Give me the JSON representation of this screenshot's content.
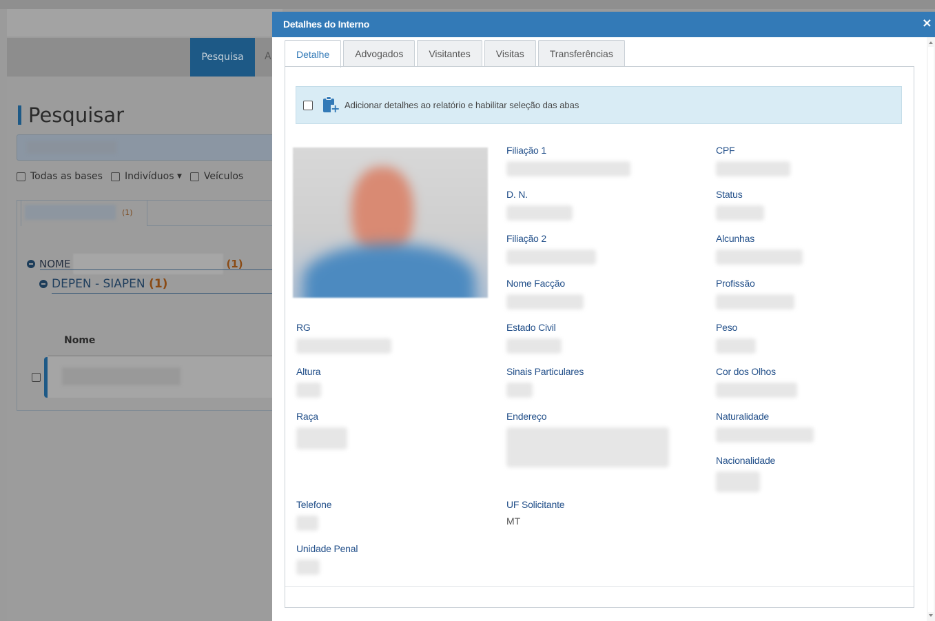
{
  "background": {
    "nav_tab_active": "Pesquisa",
    "nav_tab_next": "A",
    "page_title": "Pesquisar",
    "filters": [
      "Todas as bases",
      "Indivíduos",
      "Veículos"
    ],
    "result_tab_count": "(1)",
    "tree_nome_label": "NOME",
    "tree_nome_count": "(1)",
    "tree_source_label": "DEPEN - SIAPEN",
    "tree_source_count": "(1)",
    "table_header_nome": "Nome"
  },
  "modal": {
    "title": "Detalhes do Interno",
    "close_glyph": "×",
    "tabs": [
      "Detalhe",
      "Advogados",
      "Visitantes",
      "Visitas",
      "Transferências"
    ],
    "active_tab": "Detalhe",
    "info_bar_text": "Adicionar detalhes ao relatório e habilitar seleção das abas",
    "fields": {
      "filiacao1": "Filiação 1",
      "cpf": "CPF",
      "dn": "D. N.",
      "status": "Status",
      "filiacao2": "Filiação 2",
      "alcunhas": "Alcunhas",
      "nome_faccao": "Nome Facção",
      "profissao": "Profissão",
      "rg": "RG",
      "estado_civil": "Estado Civil",
      "peso": "Peso",
      "altura": "Altura",
      "sinais": "Sinais Particulares",
      "cor_olhos": "Cor dos Olhos",
      "raca": "Raça",
      "endereco": "Endereço",
      "naturalidade": "Naturalidade",
      "nacionalidade": "Nacionalidade",
      "telefone": "Telefone",
      "uf_solicitante": "UF Solicitante",
      "uf_solicitante_value": "MT",
      "unidade_penal": "Unidade Penal"
    }
  },
  "colors": {
    "modal_header": "#337ab7",
    "label_blue": "#23508a",
    "info_bar_bg": "#d9ecf5"
  }
}
